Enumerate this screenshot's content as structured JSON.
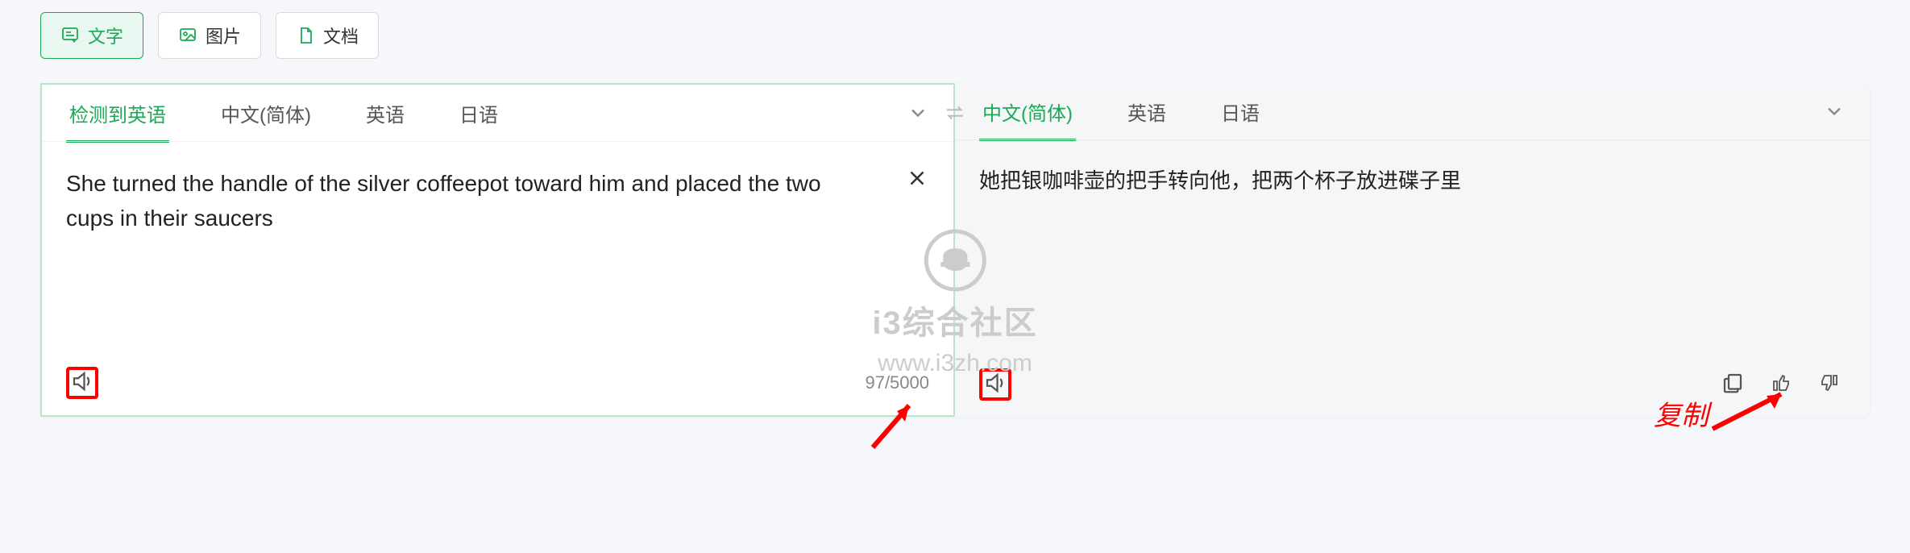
{
  "modes": {
    "text": "文字",
    "image": "图片",
    "document": "文档"
  },
  "source": {
    "tabs": {
      "detected": "检测到英语",
      "zh": "中文(简体)",
      "en": "英语",
      "ja": "日语"
    },
    "text": "She turned the handle of the silver coffeepot toward him and placed the two cups in their saucers",
    "counter": "97/5000"
  },
  "target": {
    "tabs": {
      "zh": "中文(简体)",
      "en": "英语",
      "ja": "日语"
    },
    "text": "她把银咖啡壶的把手转向他，把两个杯子放进碟子里"
  },
  "annotations": {
    "copy_label": "复制"
  },
  "watermark": {
    "title": "i3综合社区",
    "url": "www.i3zh.com"
  }
}
